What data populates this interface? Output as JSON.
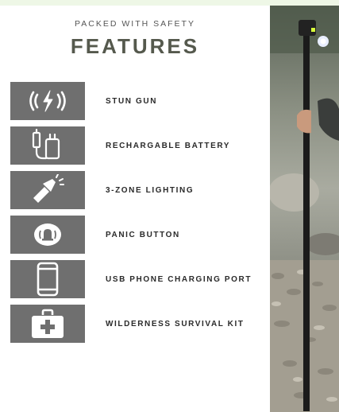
{
  "header": {
    "eyebrow": "PACKED WITH SAFETY",
    "title": "FEATURES"
  },
  "features": [
    {
      "label": "STUN GUN",
      "icon": "stun-gun-icon"
    },
    {
      "label": "RECHARGABLE BATTERY",
      "icon": "charging-plug-icon"
    },
    {
      "label": "3-ZONE LIGHTING",
      "icon": "flashlight-icon"
    },
    {
      "label": "PANIC BUTTON",
      "icon": "panic-alarm-icon"
    },
    {
      "label": "USB PHONE CHARGING PORT",
      "icon": "smartphone-icon"
    },
    {
      "label": "WILDERNESS SURVIVAL KIT",
      "icon": "first-aid-kit-icon"
    }
  ],
  "colors": {
    "icon_tile": "#6f6f6f",
    "heading": "#55594d",
    "page_tint": "#eef7e6"
  }
}
